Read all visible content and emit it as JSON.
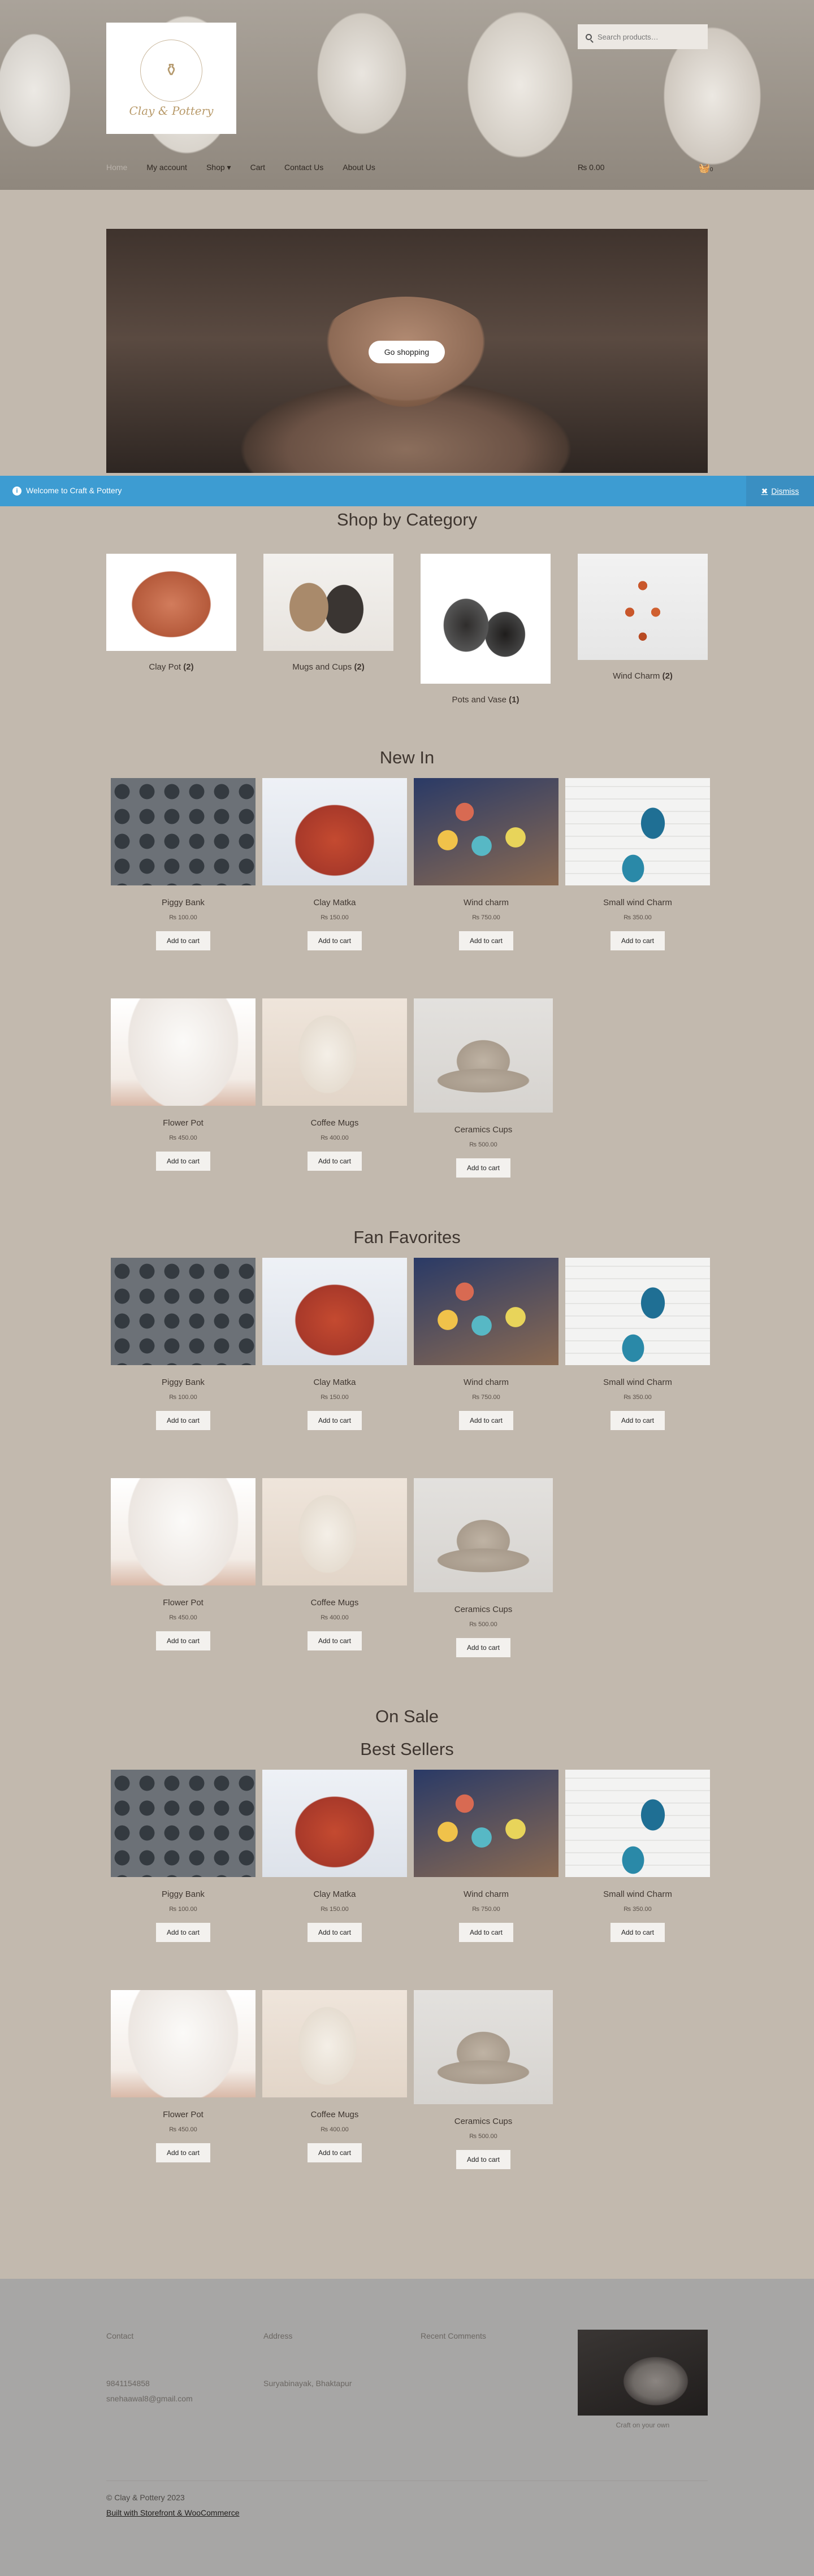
{
  "header": {
    "logo_text": "Clay & Pottery",
    "search_placeholder": "Search products…",
    "nav": [
      "Home",
      "My account",
      "Shop",
      "Cart",
      "Contact Us",
      "About Us"
    ],
    "cart_total": "₨ 0.00",
    "cart_count": "0"
  },
  "hero": {
    "button_label": "Go shopping"
  },
  "notice": {
    "text": "Welcome to Craft & Pottery",
    "dismiss_label": "Dismiss"
  },
  "categories": {
    "heading": "Shop by Category",
    "items": [
      {
        "name": "Clay Pot",
        "count": "(2)"
      },
      {
        "name": "Mugs and Cups",
        "count": "(2)"
      },
      {
        "name": "Pots and Vase",
        "count": "(1)"
      },
      {
        "name": "Wind Charm",
        "count": "(2)"
      }
    ]
  },
  "sections": [
    {
      "heading": "New In"
    },
    {
      "heading": "Fan Favorites"
    },
    {
      "heading": "On Sale"
    },
    {
      "heading": "Best Sellers"
    }
  ],
  "products": [
    {
      "name": "Piggy Bank",
      "price": "₨ 100.00",
      "cta": "Add to cart",
      "image": "piggy-bank-image"
    },
    {
      "name": "Clay Matka",
      "price": "₨ 150.00",
      "cta": "Add to cart",
      "image": "clay-matka-image"
    },
    {
      "name": "Wind charm",
      "price": "₨ 750.00",
      "cta": "Add to cart",
      "image": "wind-charm-image"
    },
    {
      "name": "Small wind Charm",
      "price": "₨ 350.00",
      "cta": "Add to cart",
      "image": "small-wind-charm-image"
    },
    {
      "name": "Flower Pot",
      "price": "₨ 450.00",
      "cta": "Add to cart",
      "image": "flower-pot-image"
    },
    {
      "name": "Coffee Mugs",
      "price": "₨ 400.00",
      "cta": "Add to cart",
      "image": "coffee-mugs-image"
    },
    {
      "name": "Ceramics Cups",
      "price": "₨ 500.00",
      "cta": "Add to cart",
      "image": "ceramics-cups-image"
    }
  ],
  "footer": {
    "contact_heading": "Contact",
    "phone": "9841154858",
    "email": "snehaawal8@gmail.com",
    "address_heading": "Address",
    "address": "Suryabinayak, Bhaktapur",
    "comments_heading": "Recent Comments",
    "image_caption": "Craft on your own",
    "copyright": "© Clay & Pottery 2023",
    "built_with": "Built with Storefront & WooCommerce"
  }
}
